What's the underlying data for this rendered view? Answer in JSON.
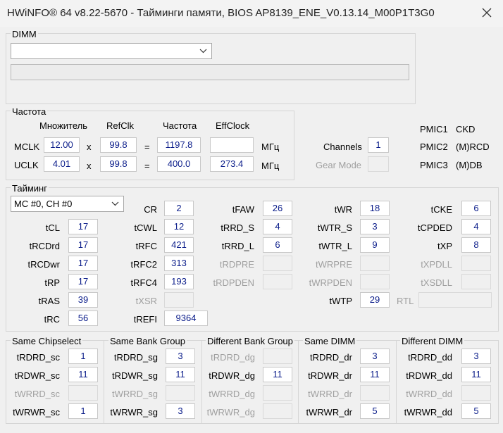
{
  "window": {
    "title": "HWiNFO® 64 v8.22-5670 - Тайминги памяти, BIOS AP8139_ENE_V0.13.14_M00P1T3G0"
  },
  "dimm": {
    "group_label": "DIMM",
    "selected": ""
  },
  "freq": {
    "group_label": "Частота",
    "headers": {
      "mult": "Множитель",
      "refclk": "RefClk",
      "freq": "Частота",
      "effclock": "EffClock"
    },
    "mclk": {
      "label": "MCLK",
      "mult": "12.00",
      "refclk": "99.8",
      "freq": "1197.8",
      "eff": "",
      "unit": "МГц"
    },
    "uclk": {
      "label": "UCLK",
      "mult": "4.01",
      "refclk": "99.8",
      "freq": "400.0",
      "eff": "273.4",
      "unit": "МГц"
    },
    "x": "x",
    "eq": "=",
    "channels_label": "Channels",
    "channels": "1",
    "gear_label": "Gear Mode",
    "gear": "",
    "pmic": [
      {
        "label": "PMIC1",
        "value": "CKD"
      },
      {
        "label": "PMIC2",
        "value": "(M)RCD"
      },
      {
        "label": "PMIC3",
        "value": "(M)DB"
      }
    ]
  },
  "timing": {
    "group_label": "Тайминг",
    "selector": "MC #0, CH #0",
    "cr": "2",
    "tcl": "17",
    "tcwl": "12",
    "trcdrd": "17",
    "trfc": "421",
    "trcdwr": "17",
    "trfc2": "313",
    "trp": "17",
    "trfc4": "193",
    "tras": "39",
    "txsr": "",
    "trc": "56",
    "trefi": "9364",
    "tfaw": "26",
    "trrd_s": "4",
    "trrd_l": "6",
    "trdpre": "",
    "trdpden": "",
    "twr": "18",
    "twtr_s": "3",
    "twtr_l": "9",
    "twrpre": "",
    "twrpden": "",
    "twtp": "29",
    "tcke": "6",
    "tcpded": "4",
    "txp": "8",
    "txpdll": "",
    "txsdll": "",
    "rtl": ""
  },
  "groups": [
    {
      "label": "Same Chipselect",
      "rows": [
        {
          "name": "tRDRD_sc",
          "value": "1"
        },
        {
          "name": "tRDWR_sc",
          "value": "11"
        },
        {
          "name": "tWRRD_sc",
          "value": ""
        },
        {
          "name": "tWRWR_sc",
          "value": "1"
        }
      ]
    },
    {
      "label": "Same Bank Group",
      "rows": [
        {
          "name": "tRDRD_sg",
          "value": "3"
        },
        {
          "name": "tRDWR_sg",
          "value": "11"
        },
        {
          "name": "tWRRD_sg",
          "value": ""
        },
        {
          "name": "tWRWR_sg",
          "value": "3"
        }
      ]
    },
    {
      "label": "Different Bank Group",
      "rows": [
        {
          "name": "tRDRD_dg",
          "value": ""
        },
        {
          "name": "tRDWR_dg",
          "value": "11"
        },
        {
          "name": "tWRRD_dg",
          "value": ""
        },
        {
          "name": "tWRWR_dg",
          "value": ""
        }
      ]
    },
    {
      "label": "Same DIMM",
      "rows": [
        {
          "name": "tRDRD_dr",
          "value": "3"
        },
        {
          "name": "tRDWR_dr",
          "value": "11"
        },
        {
          "name": "tWRRD_dr",
          "value": ""
        },
        {
          "name": "tWRWR_dr",
          "value": "5"
        }
      ]
    },
    {
      "label": "Different DIMM",
      "rows": [
        {
          "name": "tRDRD_dd",
          "value": "3"
        },
        {
          "name": "tRDWR_dd",
          "value": "11"
        },
        {
          "name": "tWRRD_dd",
          "value": ""
        },
        {
          "name": "tWRWR_dd",
          "value": "5"
        }
      ]
    }
  ],
  "labels": {
    "cr": "CR",
    "tcl": "tCL",
    "tcwl": "tCWL",
    "trcdrd": "tRCDrd",
    "trfc": "tRFC",
    "trcdwr": "tRCDwr",
    "trfc2": "tRFC2",
    "trp": "tRP",
    "trfc4": "tRFC4",
    "tras": "tRAS",
    "txsr": "tXSR",
    "trc": "tRC",
    "trefi": "tREFI",
    "tfaw": "tFAW",
    "trrd_s": "tRRD_S",
    "trrd_l": "tRRD_L",
    "trdpre": "tRDPRE",
    "trdpden": "tRDPDEN",
    "twr": "tWR",
    "twtr_s": "tWTR_S",
    "twtr_l": "tWTR_L",
    "twrpre": "tWRPRE",
    "twrpden": "tWRPDEN",
    "twtp": "tWTP",
    "tcke": "tCKE",
    "tcpded": "tCPDED",
    "txp": "tXP",
    "txpdll": "tXPDLL",
    "txsdll": "tXSDLL",
    "rtl": "RTL"
  }
}
